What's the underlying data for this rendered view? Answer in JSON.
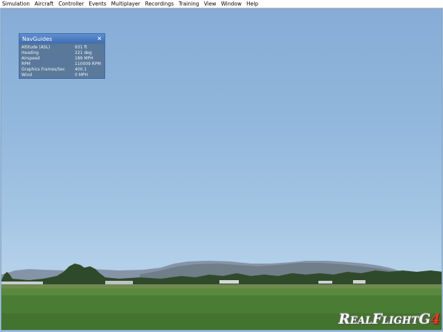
{
  "menubar": {
    "items": [
      "Simulation",
      "Aircraft",
      "Controller",
      "Events",
      "Multiplayer",
      "Recordings",
      "Training",
      "View",
      "Window",
      "Help"
    ]
  },
  "nav_guides": {
    "title": "NavGuides",
    "close_symbol": "×",
    "rows": [
      {
        "label": "Altitude (ASL)",
        "value": "931 ft"
      },
      {
        "label": "Heading",
        "value": "221 deg"
      },
      {
        "label": "Airspeed",
        "value": "189 MPH"
      },
      {
        "label": "RPM",
        "value": "110009 RPM"
      },
      {
        "label": "Graphics Frames/Sec",
        "value": "400.1"
      },
      {
        "label": "Wind",
        "value": "0 MPH"
      }
    ]
  },
  "logo": {
    "real_big": "R",
    "real_small": "EAL",
    "flight_big": "F",
    "flight_small": "LIGHT",
    "g": "G",
    "four": "4"
  },
  "colors": {
    "sky_top": "#87acd6",
    "sky_horizon": "#b9d4eb",
    "grass": "#4a7c34",
    "panel_title": "#3d6db2",
    "logo_accent": "#e23b2e"
  }
}
